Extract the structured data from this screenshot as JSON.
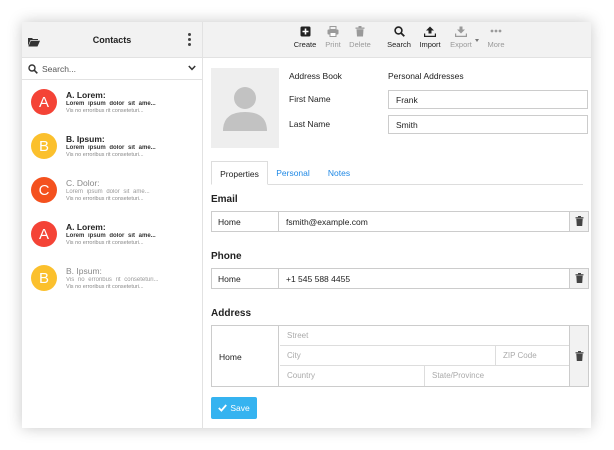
{
  "sidebar": {
    "title": "Contacts",
    "search_placeholder": "Search...",
    "contacts": [
      {
        "initial": "A",
        "name": "A. Lorem:",
        "line1": "Lorem ipsum dolor sit ame...",
        "line2": "Vis no erroribus rit conseteturi...",
        "color": "#f44336",
        "dim": false
      },
      {
        "initial": "B",
        "name": "B. Ipsum:",
        "line1": "Lorem ipsum dolor sit ame...",
        "line2": "Vis no erroribus rit conseteturi...",
        "color": "#fbc02d",
        "dim": false
      },
      {
        "initial": "C",
        "name": "C. Dolor:",
        "line1": "Lorem ipsum dolor sit ame...",
        "line2": "Vis no erroribus rit conseteturi...",
        "color": "#f4511e",
        "dim": true
      },
      {
        "initial": "A",
        "name": "A. Lorem:",
        "line1": "Lorem ipsum dolor sit ame...",
        "line2": "Vis no erroribus rit conseteturi...",
        "color": "#f44336",
        "dim": false
      },
      {
        "initial": "B",
        "name": "B. Ipsum:",
        "line1": "Vis no erroribus rit conseteturi...",
        "line2": "Vis no erroribus rit conseteturi...",
        "color": "#fbc02d",
        "dim": true
      }
    ]
  },
  "toolbar": {
    "create": "Create",
    "print": "Print",
    "delete": "Delete",
    "search": "Search",
    "import": "Import",
    "export": "Export",
    "more": "More"
  },
  "form": {
    "address_book_label": "Address Book",
    "address_book_value": "Personal Addresses",
    "first_name_label": "First Name",
    "first_name_value": "Frank",
    "last_name_label": "Last Name",
    "last_name_value": "Smith"
  },
  "tabs": {
    "properties": "Properties",
    "personal": "Personal",
    "notes": "Notes"
  },
  "email": {
    "title": "Email",
    "type": "Home",
    "value": "fsmith@example.com"
  },
  "phone": {
    "title": "Phone",
    "type": "Home",
    "value": "+1 545 588 4455"
  },
  "address": {
    "title": "Address",
    "type": "Home",
    "street": "Street",
    "city": "City",
    "zip": "ZIP Code",
    "country": "Country",
    "state": "State/Province"
  },
  "save_label": "Save",
  "colors": {
    "accent": "#35b3f0",
    "link": "#1e88e5"
  }
}
